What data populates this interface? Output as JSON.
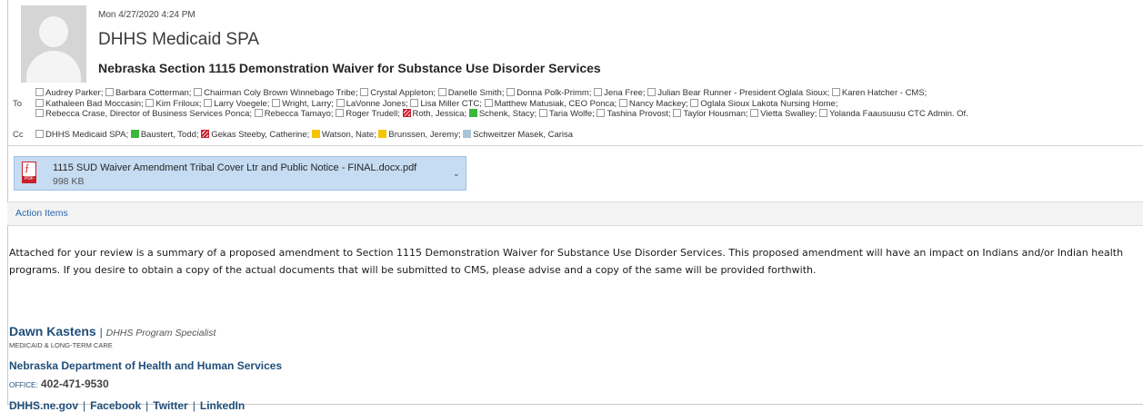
{
  "header": {
    "date": "Mon 4/27/2020 4:24 PM",
    "sender": "DHHS Medicaid SPA",
    "subject": "Nebraska Section 1115 Demonstration Waiver for Substance Use Disorder Services",
    "to_label": "To",
    "cc_label": "Cc"
  },
  "to_recipients": [
    {
      "name": "Audrey Parker;",
      "category": "none"
    },
    {
      "name": "Barbara Cotterman;",
      "category": "none"
    },
    {
      "name": "Chairman Coly Brown Winnebago Tribe;",
      "category": "none"
    },
    {
      "name": "Crystal Appleton;",
      "category": "none"
    },
    {
      "name": "Danelle Smith;",
      "category": "none"
    },
    {
      "name": "Donna Polk-Primm;",
      "category": "none"
    },
    {
      "name": "Jena Free;",
      "category": "none"
    },
    {
      "name": "Julian Bear Runner - President Oglala Sioux;",
      "category": "none"
    },
    {
      "name": "Karen Hatcher - CMS;",
      "category": "none"
    },
    {
      "name": "Kathaleen Bad Moccasin;",
      "category": "none"
    },
    {
      "name": "Kim Friloux;",
      "category": "none"
    },
    {
      "name": "Larry Voegele;",
      "category": "none"
    },
    {
      "name": "Wright, Larry;",
      "category": "none"
    },
    {
      "name": "LaVonne Jones;",
      "category": "none"
    },
    {
      "name": "Lisa Miller CTC;",
      "category": "none"
    },
    {
      "name": "Matthew Matusiak, CEO Ponca;",
      "category": "none"
    },
    {
      "name": "Nancy Mackey;",
      "category": "none"
    },
    {
      "name": "Oglala Sioux Lakota Nursing Home;",
      "category": "none"
    },
    {
      "name": "Rebecca Crase, Director of Business Services Ponca;",
      "category": "none"
    },
    {
      "name": "Rebecca Tamayo;",
      "category": "none"
    },
    {
      "name": "Roger Trudell;",
      "category": "none"
    },
    {
      "name": "Roth, Jessica;",
      "category": "red-striped"
    },
    {
      "name": "Schenk, Stacy;",
      "category": "green"
    },
    {
      "name": "Taria Wolfe;",
      "category": "none"
    },
    {
      "name": "Tashina Provost;",
      "category": "none"
    },
    {
      "name": "Taylor Housman;",
      "category": "none"
    },
    {
      "name": "Vietta Swalley;",
      "category": "none"
    },
    {
      "name": "Yolanda Faausuusu CTC Admin. Of.",
      "category": "none"
    }
  ],
  "cc_recipients": [
    {
      "name": "DHHS Medicaid SPA;",
      "category": "none"
    },
    {
      "name": "Baustert, Todd;",
      "category": "green"
    },
    {
      "name": "Gekas Steeby, Catherine;",
      "category": "red-striped"
    },
    {
      "name": "Watson, Nate;",
      "category": "yellow"
    },
    {
      "name": "Brunssen, Jeremy;",
      "category": "yellow"
    },
    {
      "name": "Schweitzer Masek, Carisa",
      "category": "light-blue"
    }
  ],
  "category_colors": {
    "green": "#3cb83c",
    "yellow": "#f5c400",
    "light-blue": "#aac4d8",
    "red-striped": "#c8202c"
  },
  "attachment": {
    "name": "1115 SUD Waiver Amendment Tribal Cover Ltr and Public Notice - FINAL.docx.pdf",
    "size": "998 KB",
    "icon": "pdf-file-icon",
    "icon_tag": "PDF",
    "menu_icon": "chevron-down-icon"
  },
  "action_bar": {
    "label": "Action Items"
  },
  "body": {
    "text": "Attached for your review is a summary of a proposed amendment to Section 1115 Demonstration Waiver for Substance Use Disorder Services. This proposed amendment will have an impact on Indians and/or Indian health programs. If you desire to obtain a copy of the actual documents that will be submitted to CMS, please advise and a copy of the same will be provided forthwith."
  },
  "signature": {
    "name": "Dawn Kastens",
    "separator": "|",
    "title": "DHHS Program Specialist",
    "department": "MEDICAID & LONG-TERM CARE",
    "organization": "Nebraska Department of Health and Human Services",
    "phone_label": "OFFICE:",
    "phone": "402-471-9530",
    "links": [
      "DHHS.ne.gov",
      "Facebook",
      "Twitter",
      "LinkedIn"
    ],
    "link_separator": "|"
  }
}
